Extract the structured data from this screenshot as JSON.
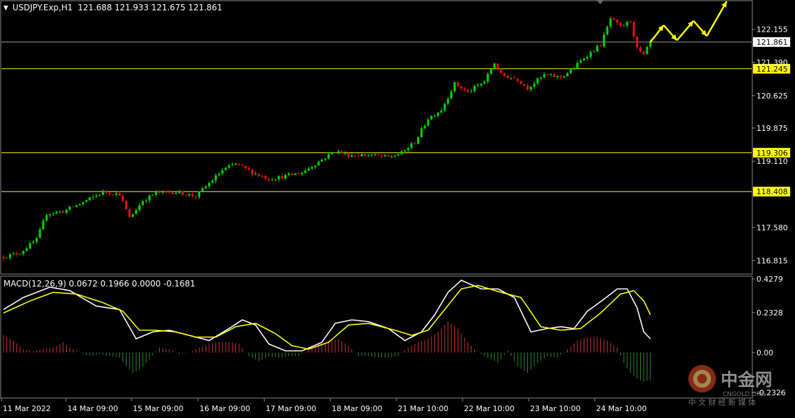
{
  "header": {
    "arrow_glyph": "▼",
    "symbol": "USDJPY.Exp,H1",
    "ohlc": "121.688 121.933 121.675 121.861"
  },
  "macd_header": "MACD(12,26,9) 0.0672 0.1966 0.0000 -0.1681",
  "colors": {
    "background": "#000000",
    "bull_candle": "#00d000",
    "bear_candle": "#e01010",
    "level_line": "#ffff00",
    "level_label_bg": "#ffff00",
    "current_price_line": "#a0a0a0",
    "macd_line": "#ffffff",
    "signal_line": "#ffff00",
    "hist_positive": "#cc3333",
    "hist_negative": "#2e8b2e",
    "forecast_arrow": "#ffff00"
  },
  "watermark": {
    "brand_cn": "中金网",
    "brand_en": "CNGOLD.ORG",
    "tagline": "中 文 财 经 新 媒 体",
    "logo_icon": "cngold-logo-icon"
  },
  "chart_data": [
    {
      "type": "candlestick",
      "title": "USDJPY.Exp,H1",
      "y_ticks": [
        "122.155",
        "121.390",
        "120.625",
        "119.875",
        "119.110",
        "117.580",
        "116.815"
      ],
      "ylim": [
        116.52,
        122.8
      ],
      "x_ticks": [
        "11 Mar 2022",
        "14 Mar 09:00",
        "15 Mar 09:00",
        "16 Mar 09:00",
        "17 Mar 09:00",
        "18 Mar 09:00",
        "21 Mar 10:00",
        "22 Mar 10:00",
        "23 Mar 10:00",
        "24 Mar 10:00"
      ],
      "current_price": "121.861",
      "horizontal_levels": [
        "121.245",
        "119.306",
        "118.408"
      ],
      "price_path": [
        [
          0,
          116.9
        ],
        [
          5,
          117.0
        ],
        [
          10,
          117.3
        ],
        [
          13,
          117.9
        ],
        [
          18,
          117.95
        ],
        [
          25,
          118.2
        ],
        [
          30,
          118.4
        ],
        [
          35,
          118.35
        ],
        [
          38,
          117.8
        ],
        [
          42,
          118.2
        ],
        [
          46,
          118.38
        ],
        [
          52,
          118.4
        ],
        [
          58,
          118.3
        ],
        [
          60,
          118.45
        ],
        [
          66,
          118.9
        ],
        [
          70,
          119.05
        ],
        [
          75,
          118.85
        ],
        [
          80,
          118.7
        ],
        [
          84,
          118.75
        ],
        [
          90,
          118.85
        ],
        [
          95,
          119.1
        ],
        [
          100,
          119.35
        ],
        [
          104,
          119.25
        ],
        [
          110,
          119.26
        ],
        [
          116,
          119.2
        ],
        [
          120,
          119.3
        ],
        [
          124,
          119.55
        ],
        [
          128,
          120.1
        ],
        [
          132,
          120.3
        ],
        [
          136,
          120.9
        ],
        [
          140,
          120.7
        ],
        [
          145,
          120.95
        ],
        [
          148,
          121.38
        ],
        [
          150,
          121.1
        ],
        [
          155,
          121.0
        ],
        [
          158,
          120.8
        ],
        [
          163,
          121.1
        ],
        [
          168,
          121.05
        ],
        [
          171,
          121.2
        ],
        [
          175,
          121.5
        ],
        [
          180,
          121.8
        ],
        [
          183,
          122.4
        ],
        [
          186,
          122.2
        ],
        [
          189,
          122.35
        ],
        [
          191,
          121.7
        ],
        [
          193,
          121.55
        ],
        [
          195,
          121.86
        ]
      ],
      "forecast_path": [
        [
          195,
          121.86
        ],
        [
          199,
          122.25
        ],
        [
          203,
          121.9
        ],
        [
          208,
          122.35
        ],
        [
          212,
          122.0
        ],
        [
          218,
          122.8
        ]
      ]
    },
    {
      "type": "line",
      "title": "MACD(12,26,9) 0.0672 0.1966 0.0000 -0.1681",
      "y_ticks": [
        "0.4279",
        "0.2328",
        "0.00",
        "-0.2326"
      ],
      "ylim": [
        -0.26,
        0.44
      ],
      "series": [
        {
          "name": "MACD",
          "values": [
            [
              0,
              0.25
            ],
            [
              6,
              0.32
            ],
            [
              14,
              0.38
            ],
            [
              20,
              0.36
            ],
            [
              28,
              0.27
            ],
            [
              35,
              0.25
            ],
            [
              40,
              0.08
            ],
            [
              45,
              0.12
            ],
            [
              50,
              0.13
            ],
            [
              56,
              0.1
            ],
            [
              62,
              0.07
            ],
            [
              68,
              0.14
            ],
            [
              72,
              0.19
            ],
            [
              76,
              0.16
            ],
            [
              80,
              0.05
            ],
            [
              85,
              0.01
            ],
            [
              90,
              0.01
            ],
            [
              96,
              0.06
            ],
            [
              100,
              0.17
            ],
            [
              105,
              0.19
            ],
            [
              110,
              0.18
            ],
            [
              116,
              0.14
            ],
            [
              121,
              0.07
            ],
            [
              126,
              0.12
            ],
            [
              130,
              0.22
            ],
            [
              134,
              0.35
            ],
            [
              138,
              0.42
            ],
            [
              144,
              0.37
            ],
            [
              149,
              0.37
            ],
            [
              154,
              0.32
            ],
            [
              159,
              0.12
            ],
            [
              164,
              0.14
            ],
            [
              168,
              0.15
            ],
            [
              172,
              0.14
            ],
            [
              176,
              0.24
            ],
            [
              181,
              0.31
            ],
            [
              185,
              0.37
            ],
            [
              188,
              0.37
            ],
            [
              191,
              0.26
            ],
            [
              193,
              0.12
            ],
            [
              195,
              0.08
            ]
          ]
        },
        {
          "name": "Signal",
          "values": [
            [
              0,
              0.23
            ],
            [
              8,
              0.3
            ],
            [
              15,
              0.35
            ],
            [
              22,
              0.34
            ],
            [
              30,
              0.29
            ],
            [
              36,
              0.24
            ],
            [
              41,
              0.13
            ],
            [
              46,
              0.13
            ],
            [
              52,
              0.12
            ],
            [
              58,
              0.09
            ],
            [
              64,
              0.09
            ],
            [
              70,
              0.15
            ],
            [
              76,
              0.17
            ],
            [
              82,
              0.11
            ],
            [
              87,
              0.04
            ],
            [
              92,
              0.02
            ],
            [
              98,
              0.06
            ],
            [
              104,
              0.16
            ],
            [
              110,
              0.17
            ],
            [
              118,
              0.13
            ],
            [
              123,
              0.1
            ],
            [
              128,
              0.13
            ],
            [
              133,
              0.25
            ],
            [
              138,
              0.37
            ],
            [
              143,
              0.39
            ],
            [
              150,
              0.35
            ],
            [
              156,
              0.32
            ],
            [
              162,
              0.15
            ],
            [
              168,
              0.13
            ],
            [
              174,
              0.14
            ],
            [
              180,
              0.23
            ],
            [
              186,
              0.34
            ],
            [
              190,
              0.36
            ],
            [
              193,
              0.3
            ],
            [
              195,
              0.22
            ]
          ]
        },
        {
          "name": "Histogram",
          "values": [
            [
              0,
              0.1
            ],
            [
              3,
              0.07
            ],
            [
              6,
              0.02
            ],
            [
              9,
              0.01
            ],
            [
              12,
              0.02
            ],
            [
              15,
              0.03
            ],
            [
              18,
              0.06
            ],
            [
              20,
              0.03
            ],
            [
              23,
              0.0
            ],
            [
              26,
              -0.02
            ],
            [
              29,
              -0.01
            ],
            [
              32,
              -0.02
            ],
            [
              35,
              -0.03
            ],
            [
              37,
              -0.08
            ],
            [
              39,
              -0.12
            ],
            [
              41,
              -0.1
            ],
            [
              44,
              -0.04
            ],
            [
              47,
              0.03
            ],
            [
              50,
              0.02
            ],
            [
              53,
              -0.01
            ],
            [
              56,
              0.0
            ],
            [
              59,
              0.03
            ],
            [
              62,
              0.05
            ],
            [
              65,
              0.06
            ],
            [
              68,
              0.06
            ],
            [
              71,
              0.05
            ],
            [
              74,
              -0.02
            ],
            [
              77,
              -0.05
            ],
            [
              80,
              -0.02
            ],
            [
              83,
              -0.03
            ],
            [
              86,
              -0.02
            ],
            [
              89,
              -0.02
            ],
            [
              92,
              0.02
            ],
            [
              95,
              0.05
            ],
            [
              98,
              0.06
            ],
            [
              101,
              0.08
            ],
            [
              104,
              0.04
            ],
            [
              107,
              -0.02
            ],
            [
              110,
              -0.02
            ],
            [
              113,
              -0.03
            ],
            [
              116,
              -0.03
            ],
            [
              119,
              -0.02
            ],
            [
              122,
              0.03
            ],
            [
              125,
              0.06
            ],
            [
              128,
              0.08
            ],
            [
              131,
              0.12
            ],
            [
              134,
              0.18
            ],
            [
              137,
              0.14
            ],
            [
              140,
              0.06
            ],
            [
              143,
              0.0
            ],
            [
              146,
              -0.03
            ],
            [
              149,
              -0.06
            ],
            [
              152,
              0.01
            ],
            [
              155,
              -0.08
            ],
            [
              158,
              -0.12
            ],
            [
              161,
              -0.06
            ],
            [
              164,
              -0.02
            ],
            [
              167,
              -0.03
            ],
            [
              170,
              0.02
            ],
            [
              173,
              0.07
            ],
            [
              176,
              0.09
            ],
            [
              179,
              0.09
            ],
            [
              182,
              0.07
            ],
            [
              185,
              0.03
            ],
            [
              187,
              -0.06
            ],
            [
              189,
              -0.12
            ],
            [
              191,
              -0.15
            ],
            [
              193,
              -0.17
            ],
            [
              195,
              -0.16
            ]
          ]
        }
      ]
    }
  ]
}
